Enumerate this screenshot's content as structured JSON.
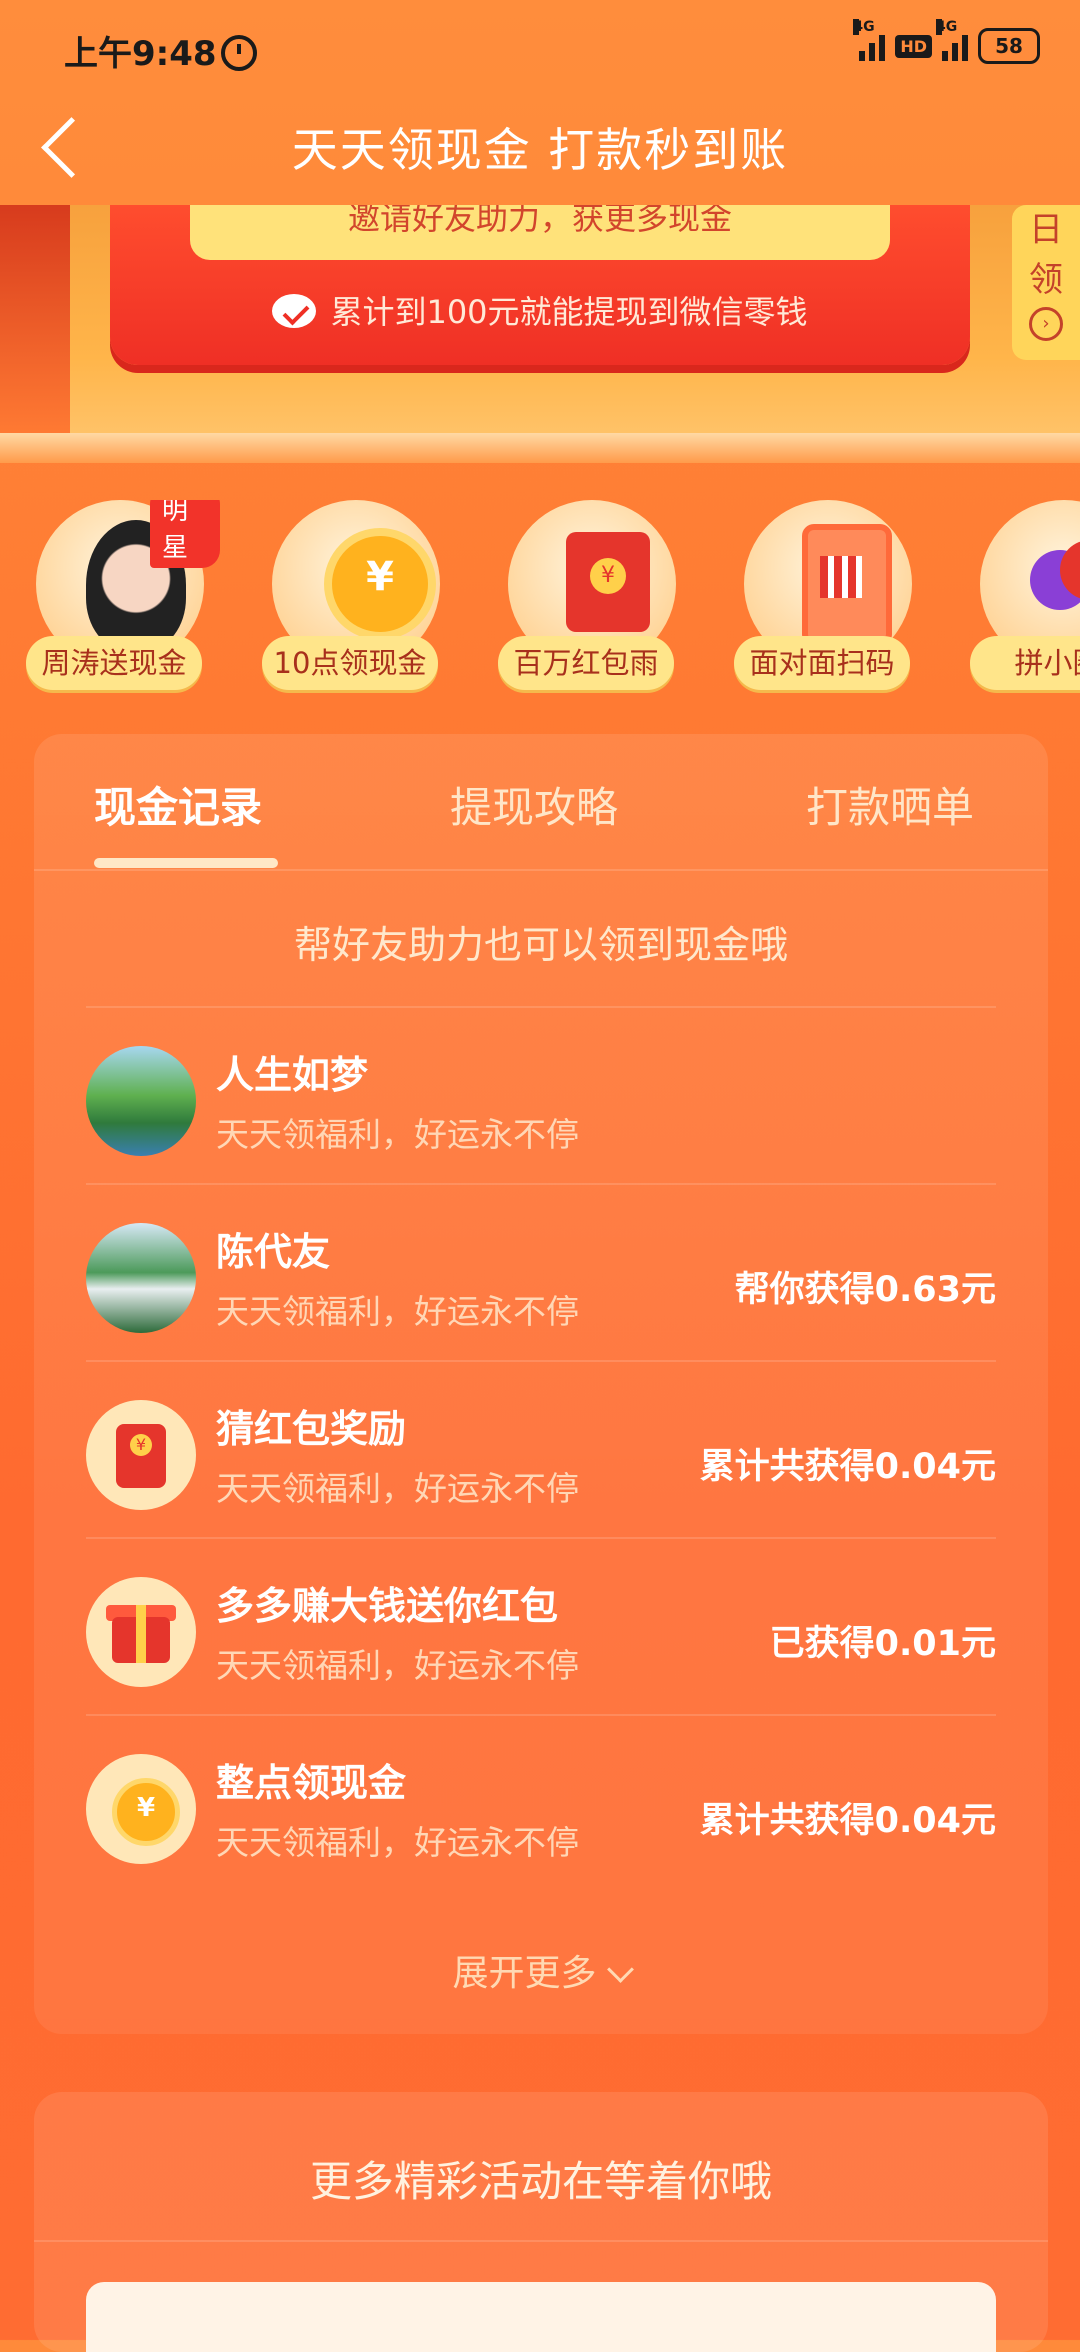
{
  "status_bar": {
    "time": "上午9:48",
    "network_1": "4G",
    "hd": "HD",
    "network_2": "4G",
    "battery": "58"
  },
  "header": {
    "title": "天天领现金 打款秒到账"
  },
  "banner": {
    "invite_text": "邀请好友助力，获更多现金",
    "note": "累计到100元就能提现到微信零钱",
    "daily_tag": [
      "日",
      "领"
    ]
  },
  "shortcuts": [
    {
      "label": "周涛送现金",
      "badge": "明星",
      "icon": "celebrity-avatar-icon"
    },
    {
      "label": "10点领现金",
      "icon": "alarm-clock-icon"
    },
    {
      "label": "百万红包雨",
      "icon": "red-envelope-icon"
    },
    {
      "label": "面对面扫码",
      "icon": "qr-phone-icon"
    },
    {
      "label": "拼小圈",
      "icon": "circle-bubbles-icon"
    }
  ],
  "tabs": [
    "现金记录",
    "提现攻略",
    "打款晒单"
  ],
  "hint": "帮好友助力也可以领到现金哦",
  "records": [
    {
      "title": "人生如梦",
      "subtitle": "天天领福利，好运永不停",
      "amount": "",
      "icon": "landscape-avatar-icon"
    },
    {
      "title": "陈代友",
      "subtitle": "天天领福利，好运永不停",
      "amount": "帮你获得0.63元",
      "icon": "waterfall-avatar-icon"
    },
    {
      "title": "猜红包奖励",
      "subtitle": "天天领福利，好运永不停",
      "amount": "累计共获得0.04元",
      "icon": "red-envelope-icon"
    },
    {
      "title": "多多赚大钱送你红包",
      "subtitle": "天天领福利，好运永不停",
      "amount": "已获得0.01元",
      "icon": "gift-box-icon"
    },
    {
      "title": "整点领现金",
      "subtitle": "天天领福利，好运永不停",
      "amount": "累计共获得0.04元",
      "icon": "alarm-clock-icon"
    }
  ],
  "expand_label": "展开更多",
  "more_section": {
    "title": "更多精彩活动在等着你哦"
  },
  "colors": {
    "background": "#ff7a33",
    "accent_yellow": "#ffe58a",
    "red": "#e5352c"
  }
}
